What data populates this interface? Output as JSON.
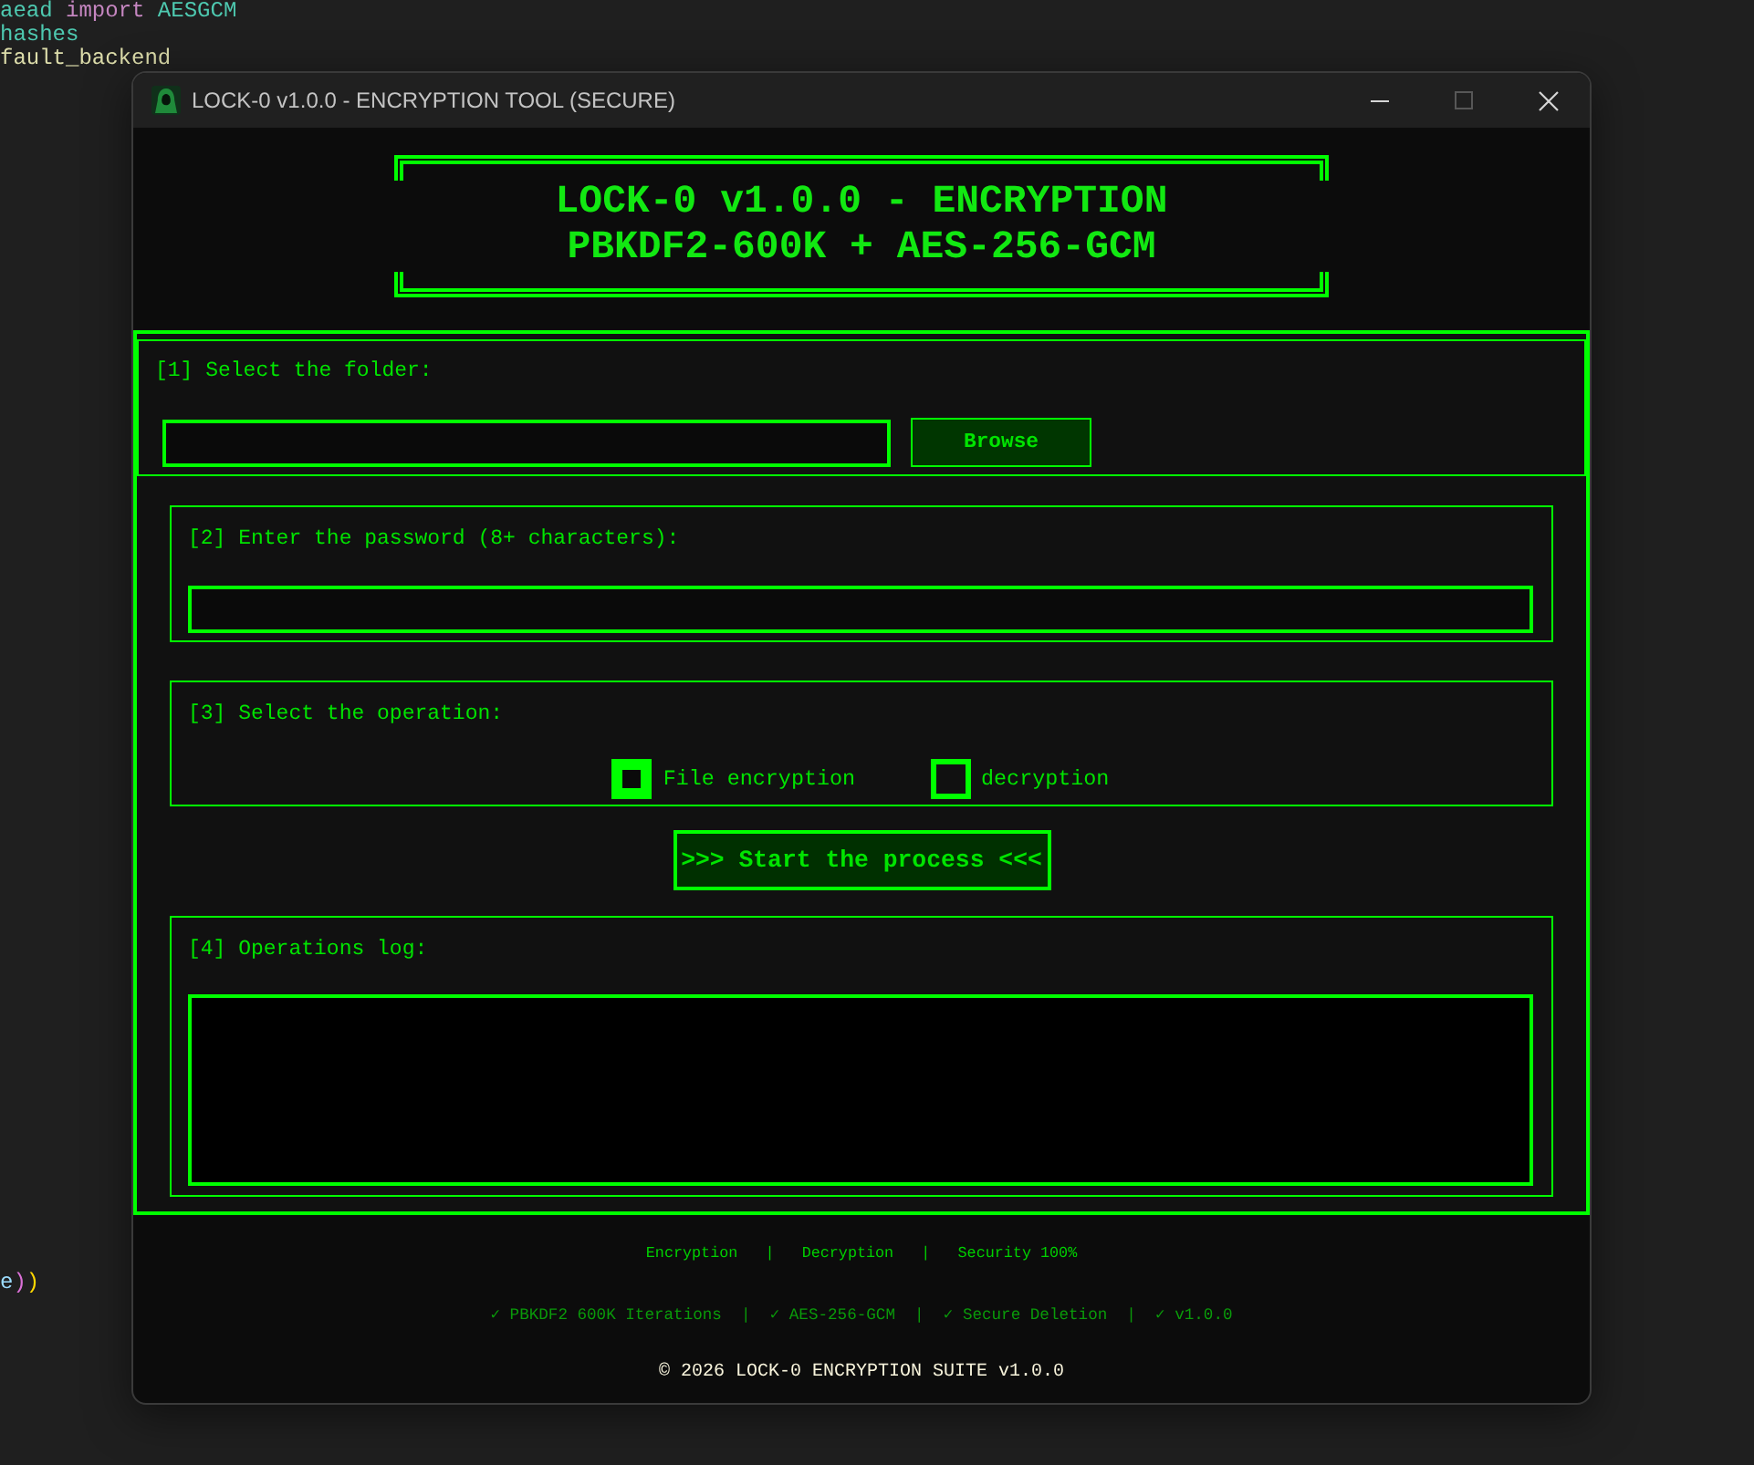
{
  "editor": {
    "top_lines": [
      {
        "tokens": [
          {
            "text": "aead",
            "color": "#4ec9b0"
          },
          {
            "text": " import",
            "color": "#c586c0"
          },
          {
            "text": " AESGCM",
            "color": "#4ec9b0"
          }
        ]
      },
      {
        "tokens": [
          {
            "text": "hashes",
            "color": "#4ec9b0"
          }
        ]
      },
      {
        "tokens": [
          {
            "text": "fault_backend",
            "color": "#dcdcaa"
          }
        ]
      }
    ],
    "bottom_lines": [
      {
        "tokens": [
          {
            "text": "e",
            "color": "#9cdcfe"
          },
          {
            "text": ")",
            "color": "#da70d6"
          },
          {
            "text": ")",
            "color": "#ffd700"
          }
        ]
      }
    ]
  },
  "window": {
    "title": "LOCK-0 v1.0.0 - ENCRYPTION TOOL (SECURE)",
    "controls": [
      {
        "kind": "minimize",
        "disabled": false
      },
      {
        "kind": "maximize",
        "disabled": true
      },
      {
        "kind": "close",
        "disabled": false
      }
    ]
  },
  "banner": {
    "lines": [
      "LOCK-0 v1.0.0 - ENCRYPTION",
      "PBKDF2-600K + AES-256-GCM"
    ]
  },
  "folder_section": {
    "label": "[1] Select the folder:",
    "browse_button": "Browse"
  },
  "password_section": {
    "label": "[2] Enter the password (8+ characters):"
  },
  "operation_section": {
    "label": "[3] Select the operation:",
    "options": [
      {
        "label": "File encryption",
        "selected": true
      },
      {
        "label": "decryption",
        "selected": false
      }
    ]
  },
  "start_button": ">>> Start the process <<<",
  "log_section": {
    "label": "[4] Operations log:"
  },
  "footer": {
    "features": "Encryption   |   Decryption   |   Security 100%",
    "checks": "✓ PBKDF2 600K Iterations  |  ✓ AES-256-GCM  |  ✓ Secure Deletion  |  ✓ v1.0.0",
    "copyright": "© 2026 LOCK-0 ENCRYPTION SUITE v1.0.0"
  }
}
